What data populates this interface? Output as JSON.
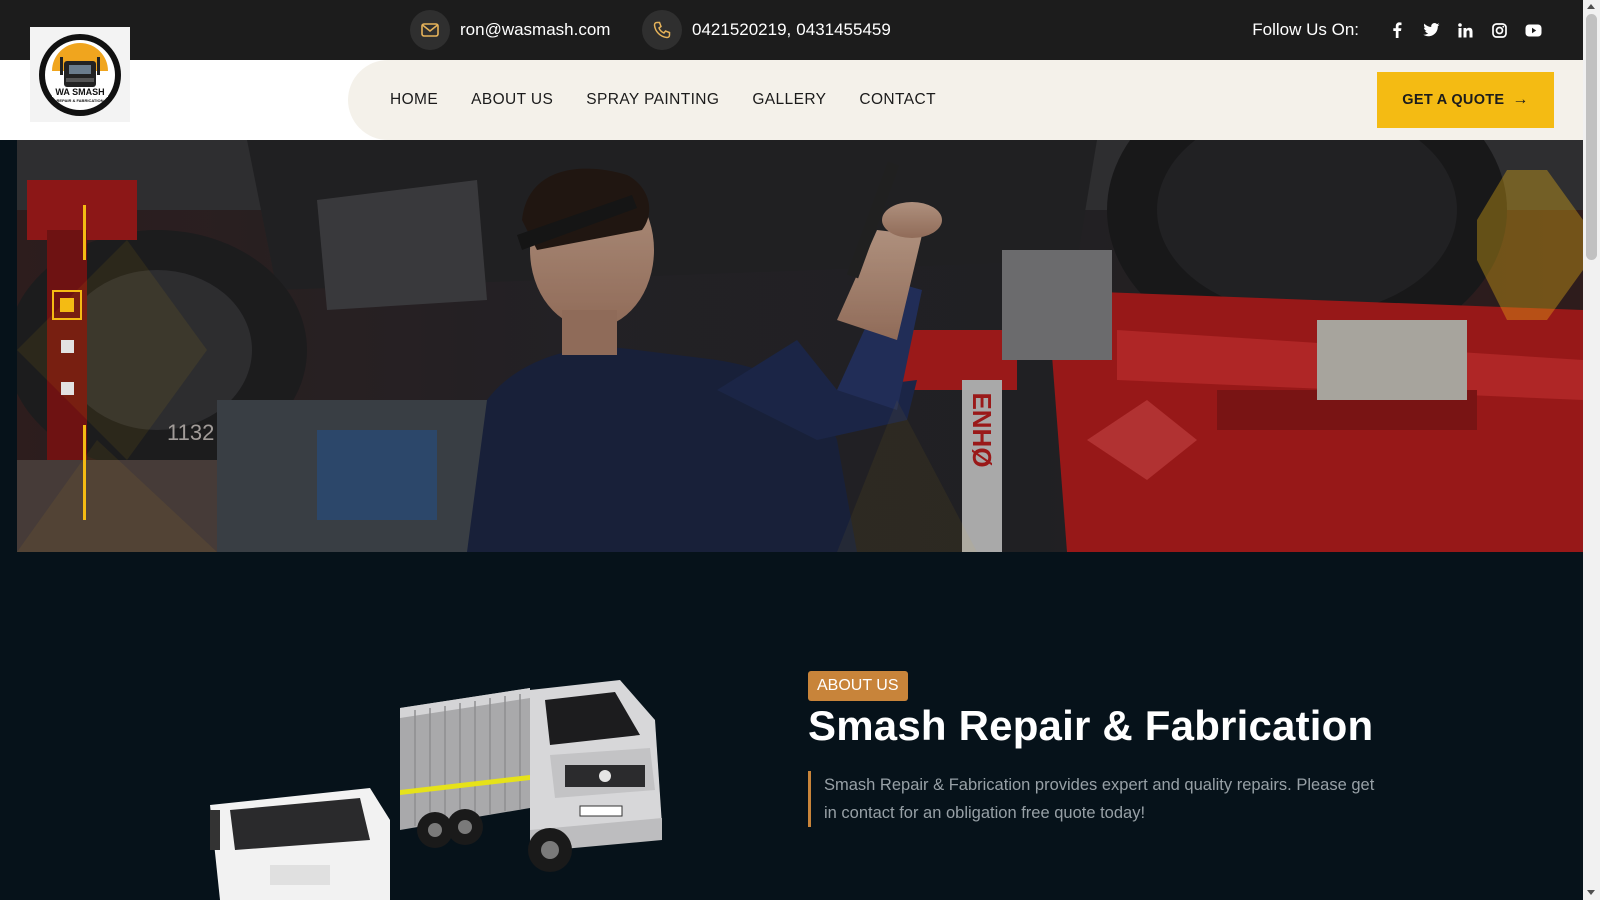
{
  "topbar": {
    "email": "ron@wasmash.com",
    "phone_primary": "0421520219",
    "phone_separator": ",",
    "phone_secondary": "0431455459",
    "follow_label": "Follow Us On:",
    "social_icons": [
      "facebook-icon",
      "twitter-icon",
      "linkedin-icon",
      "instagram-icon",
      "youtube-icon"
    ]
  },
  "logo": {
    "line1": "WA SMASH",
    "line2": "REPAIR & FABRICATION"
  },
  "nav": {
    "items": [
      {
        "label": "HOME"
      },
      {
        "label": "ABOUT US"
      },
      {
        "label": "SPRAY PAINTING"
      },
      {
        "label": "GALLERY"
      },
      {
        "label": "CONTACT"
      }
    ],
    "cta": "GET A QUOTE"
  },
  "hero": {
    "slides_count": 3,
    "active_slide": 1,
    "lift_text": "ENHØ",
    "wall_number": "1132"
  },
  "about": {
    "tag": "ABOUT US",
    "title": "Smash Repair & Fabrication",
    "text": "Smash Repair & Fabrication provides expert and quality repairs. Please get in contact for an obligation free quote today!"
  },
  "colors": {
    "accent_yellow": "#f4bb13",
    "accent_bronze": "#c8843a",
    "topbar_bg": "#1c1c1c",
    "about_bg": "#06121a"
  }
}
